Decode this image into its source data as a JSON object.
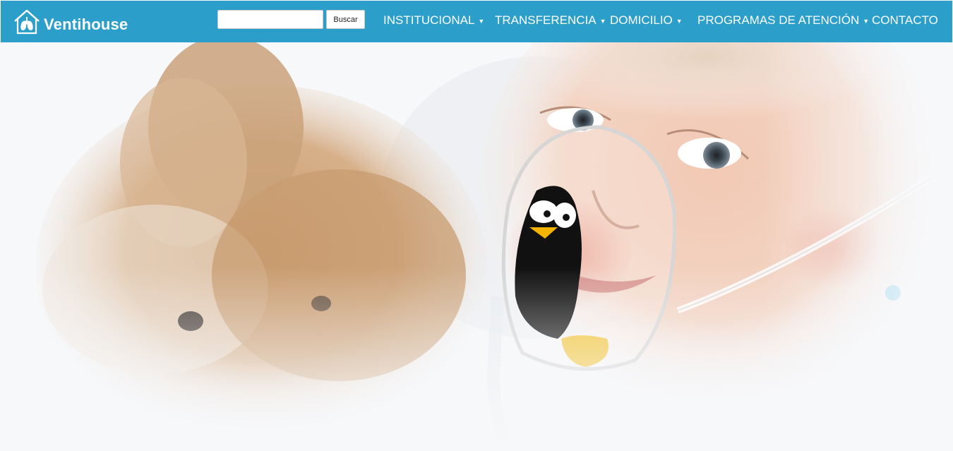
{
  "brand": {
    "name": "Ventihouse",
    "logo_icon": "house-lungs-icon"
  },
  "search": {
    "placeholder": "",
    "value": "",
    "button_label": "Buscar"
  },
  "nav": {
    "items": [
      {
        "label": "INSTITUCIONAL",
        "has_dropdown": true
      },
      {
        "label": "TRANSFERENCIA",
        "has_dropdown": true
      },
      {
        "label": "DOMICILIO",
        "has_dropdown": true
      },
      {
        "label": "PROGRAMAS DE ATENCIÓN",
        "has_dropdown": true
      },
      {
        "label": "CONTACTO",
        "has_dropdown": false
      }
    ],
    "caret_glyph": "▼"
  },
  "colors": {
    "navbar": "#2b9fca",
    "text_on_nav": "#ffffff",
    "page_bg": "#f7f8fa"
  },
  "hero": {
    "image": "child-with-penguin-oxygen-mask-and-plush-bunny"
  }
}
